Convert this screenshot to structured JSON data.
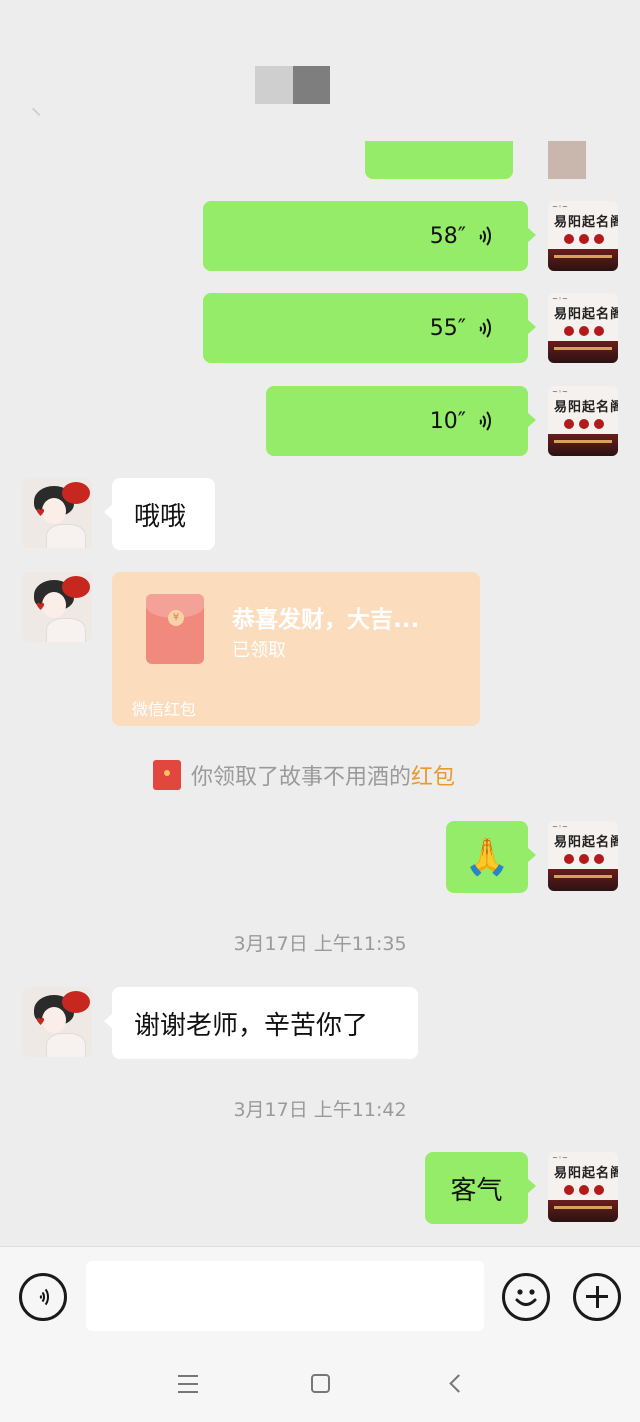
{
  "messages": {
    "voice_1": "58″",
    "voice_2": "55″",
    "voice_3": "10″",
    "text_oho": "哦哦",
    "red_packet": {
      "title": "恭喜发财，大吉...",
      "status": "已领取",
      "brand": "微信红包"
    },
    "notice": {
      "prefix": "你领取了故事不用酒的",
      "link": "红包"
    },
    "emoji_reply": "🙏",
    "time_1": "3月17日 上午11:35",
    "text_thanks": "谢谢老师，辛苦你了",
    "time_2": "3月17日 上午11:42",
    "text_reply": "客气"
  },
  "avatar_me": {
    "sign": "易阳起名阁"
  },
  "colors": {
    "outgoing_bubble": "#95ec69",
    "incoming_bubble": "#ffffff",
    "packet": "#fbdcbd",
    "link": "#e99a2e"
  },
  "icons": {
    "voice_input": "voice-icon",
    "emoji": "smiley-icon",
    "more": "plus-icon"
  }
}
